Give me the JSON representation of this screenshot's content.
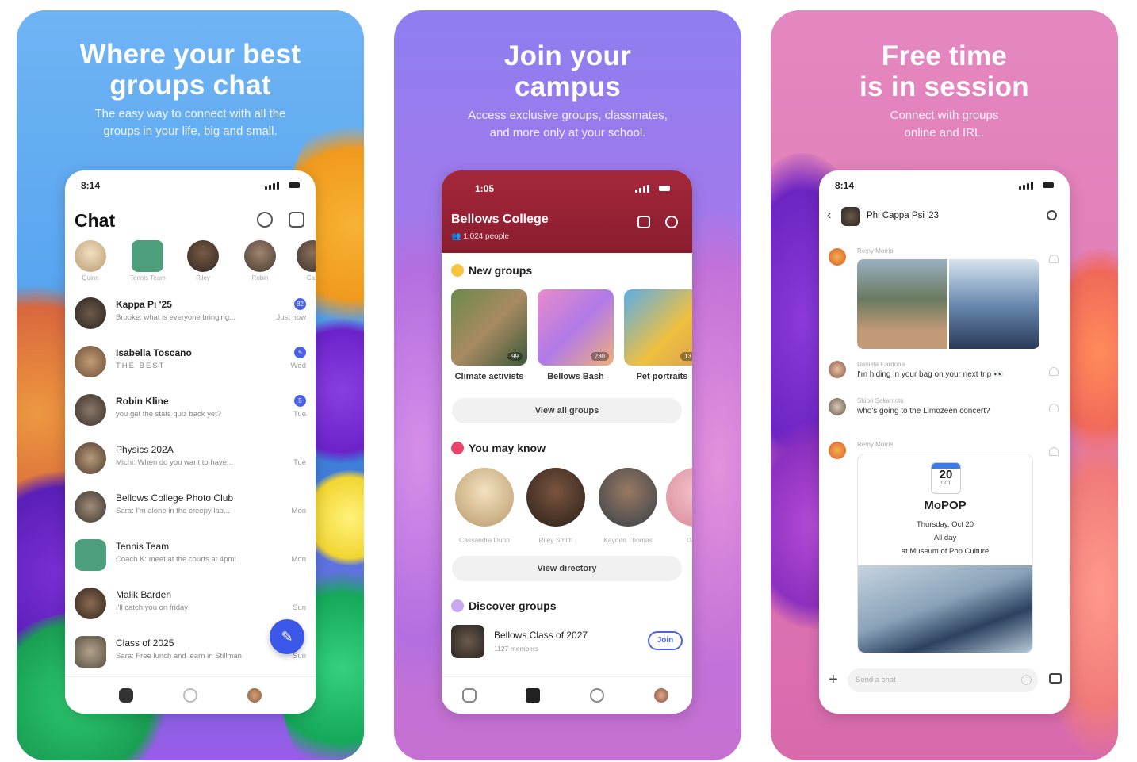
{
  "panels": [
    {
      "headline_line1": "Where your best",
      "headline_line2": "groups chat",
      "sub_line1": "The easy way to connect with all the",
      "sub_line2": "groups in your life, big and small.",
      "phone": {
        "time": "8:14",
        "title": "Chat",
        "stories": [
          "Quinn",
          "Tennis Team",
          "Riley",
          "Robin",
          "Cas"
        ],
        "chats": [
          {
            "name": "Kappa Pi '25",
            "preview": "Brooke: what is everyone bringing...",
            "time": "Just now",
            "badge": "82"
          },
          {
            "name": "Isabella Toscano",
            "preview": "THE BEST",
            "time": "Wed",
            "badge": "5"
          },
          {
            "name": "Robin Kline",
            "preview": "you get the stats quiz back yet?",
            "time": "Tue",
            "badge": "5"
          },
          {
            "name": "Physics 202A",
            "preview": "Michi: When do you want to have...",
            "time": "Tue"
          },
          {
            "name": "Bellows College Photo Club",
            "preview": "Sara: I'm alone in the creepy lab...",
            "time": "Mon"
          },
          {
            "name": "Tennis Team",
            "preview": "Coach K: meet at the courts at 4pm!",
            "time": "Mon"
          },
          {
            "name": "Malik Barden",
            "preview": "I'll catch you on friday",
            "time": "Sun"
          },
          {
            "name": "Class of 2025",
            "preview": "Sara: Free lunch and learn in Stillman",
            "time": "Sun"
          }
        ]
      }
    },
    {
      "headline_line1": "Join your",
      "headline_line2": "campus",
      "sub_line1": "Access exclusive groups, classmates,",
      "sub_line2": "and more only at your school.",
      "phone": {
        "time": "1:05",
        "college": "Bellows College",
        "people": "1,024 people",
        "new_groups_title": "New groups",
        "groups": [
          {
            "label": "Climate activists",
            "count": "99"
          },
          {
            "label": "Bellows Bash",
            "count": "230"
          },
          {
            "label": "Pet portraits",
            "count": "13"
          }
        ],
        "view_all": "View all groups",
        "you_may_know_title": "You may know",
        "people_list": [
          "Cassandra Dunn",
          "Riley Smith",
          "Kayden Thomas",
          "Danie"
        ],
        "view_directory": "View directory",
        "discover_title": "Discover groups",
        "discover_name": "Bellows Class of 2027",
        "discover_members": "1127 members",
        "join": "Join"
      }
    },
    {
      "headline_line1": "Free time",
      "headline_line2": "is in session",
      "sub_line1": "Connect with groups",
      "sub_line2": "online and IRL.",
      "phone": {
        "time": "8:14",
        "group": "Phi Cappa Psi '23",
        "messages": [
          {
            "name": "Remy Morris",
            "text": ""
          },
          {
            "name": "Daniela Cardona",
            "text": "I'm hiding in your bag on your next trip 👀"
          },
          {
            "name": "Shiori Sakamoto",
            "text": "who's going to the Limozeen concert?"
          },
          {
            "name": "Remy Morris",
            "text": ""
          }
        ],
        "event": {
          "day": "20",
          "month": "OCT",
          "title": "MoPOP",
          "date": "Thursday, Oct 20",
          "when": "All day",
          "where": "at Museum of Pop Culture"
        },
        "composer_placeholder": "Send a chat"
      }
    }
  ],
  "colors": {
    "accent": "#3b57e8",
    "campus": "#931f33"
  }
}
